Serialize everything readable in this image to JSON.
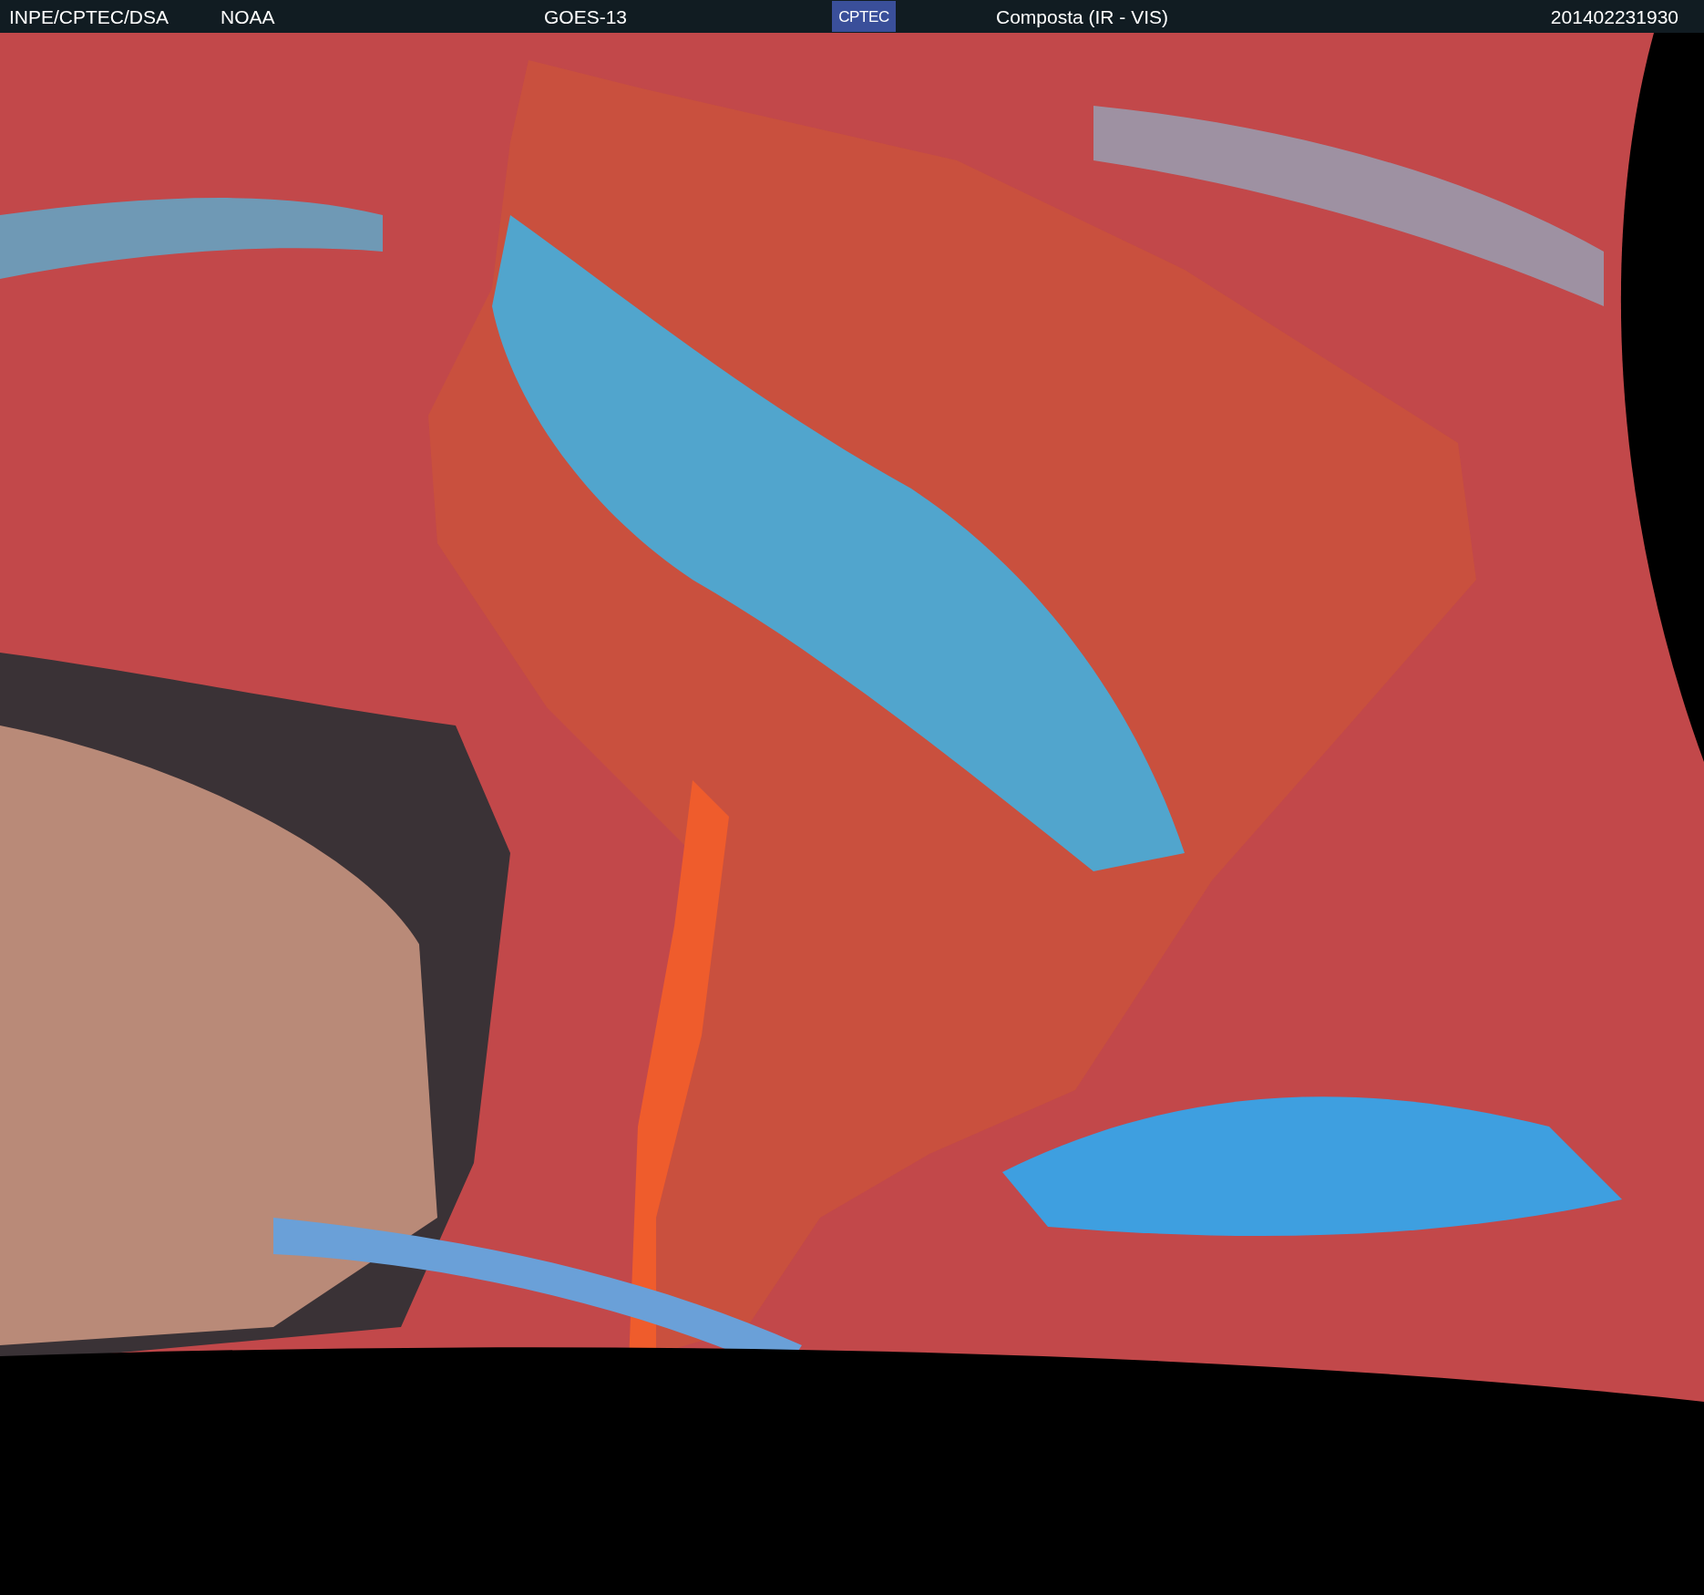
{
  "header": {
    "credit": "INPE/CPTEC/DSA",
    "agency": "NOAA",
    "satellite": "GOES-13",
    "logo": "CPTEC",
    "product": "Composta (IR - VIS)",
    "timestamp": "201402231930"
  }
}
